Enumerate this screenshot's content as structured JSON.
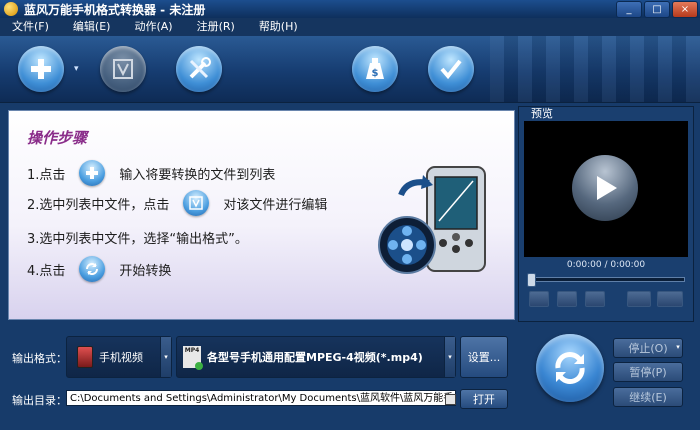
{
  "window": {
    "title": "蓝风万能手机格式转换器 - 未注册",
    "min_label": "_",
    "max_label": "□",
    "close_label": "×"
  },
  "menu": [
    "文件(F)",
    "编辑(E)",
    "动作(A)",
    "注册(R)",
    "帮助(H)"
  ],
  "toolbar": {
    "add_dropdown": "▾"
  },
  "steps": {
    "title": "操作步骤",
    "step1_pre": "1.点击",
    "step1_post": "输入将要转换的文件到列表",
    "step2_pre": "2.选中列表中文件，点击",
    "step2_post": "对该文件进行编辑",
    "step3": "3.选中列表中文件，选择“输出格式”。",
    "step4_pre": "4.点击",
    "step4_post": "开始转换"
  },
  "preview": {
    "label": "预览",
    "time": "0:00:00 / 0:00:00"
  },
  "output": {
    "format_label": "输出格式：",
    "device_value": "手机视频",
    "format_value": "各型号手机通用配置MPEG-4视频(*.mp4)",
    "mp4_badge": "MP4",
    "settings_button": "设置...",
    "dir_label": "输出目录：",
    "dir_value": "C:\\Documents and Settings\\Administrator\\My Documents\\蓝风软件\\蓝风万能手机格式",
    "open_button": "打开"
  },
  "controls": {
    "stop_button": "停止(O)",
    "pause_button": "暂停(P)",
    "resume_button": "继续(E)"
  }
}
